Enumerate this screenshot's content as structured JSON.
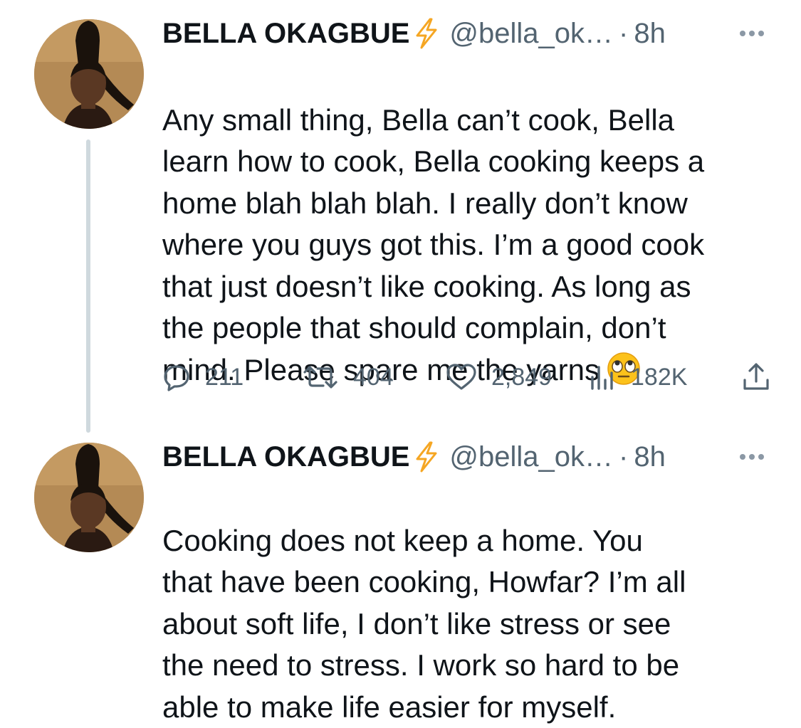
{
  "tweets": [
    {
      "author": {
        "display_name": "BELLA OKAGBUE",
        "badge_icon": "lightning-bolt-icon",
        "handle": "@bella_ok…",
        "separator": "·",
        "time": "8h"
      },
      "text": "Any small thing, Bella can’t cook, Bella\nlearn how to cook, Bella cooking keeps a\nhome blah blah blah. I really don’t know\nwhere you guys got this. I’m a good cook\nthat just doesn’t like cooking. As long as\nthe people that should complain, don’t\nmind. Please spare me the yarns",
      "emoji": "face-with-rolling-eyes",
      "stats": {
        "replies": "211",
        "retweets": "404",
        "likes": "2,849",
        "views": "182K"
      }
    },
    {
      "author": {
        "display_name": "BELLA OKAGBUE",
        "badge_icon": "lightning-bolt-icon",
        "handle": "@bella_ok…",
        "separator": "·",
        "time": "8h"
      },
      "text": "Cooking does not keep a home. You\nthat have been cooking, Howfar? I’m all\nabout soft life, I don’t like stress or see\nthe need to stress. I work so hard to be\nable to make life easier for myself."
    }
  ],
  "colors": {
    "text": "#0f1419",
    "secondary": "#536471",
    "bolt": "#f5a623",
    "thread_line": "#cfd9de"
  }
}
